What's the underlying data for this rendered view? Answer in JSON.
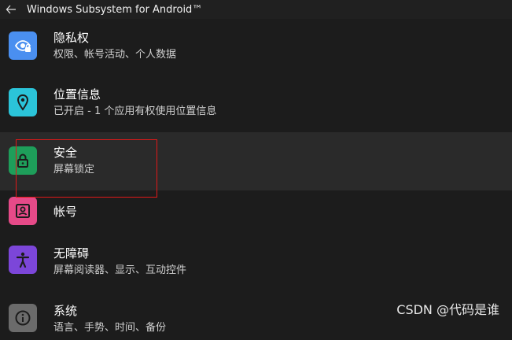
{
  "window": {
    "title": "Windows Subsystem for Android™"
  },
  "settings": {
    "items": [
      {
        "icon": "privacy-eye-lock-icon",
        "color": "#4a8ff0",
        "label": "隐私权",
        "description": "权限、帐号活动、个人数据"
      },
      {
        "icon": "location-pin-icon",
        "color": "#2bc4d9",
        "label": "位置信息",
        "description": "已开启 - 1 个应用有权使用位置信息"
      },
      {
        "icon": "lock-icon",
        "color": "#1e9e5a",
        "label": "安全",
        "description": "屏幕锁定"
      },
      {
        "icon": "account-id-card-icon",
        "color": "#e64a88",
        "label": "帐号",
        "description": ""
      },
      {
        "icon": "accessibility-person-icon",
        "color": "#7c46d9",
        "label": "无障碍",
        "description": "屏幕阅读器、显示、互动控件"
      },
      {
        "icon": "info-icon",
        "color": "#6b6b6b",
        "label": "系统",
        "description": "语言、手势、时间、备份"
      }
    ]
  },
  "watermark": "CSDN @代码是谁",
  "highlight_color": "#e01818"
}
